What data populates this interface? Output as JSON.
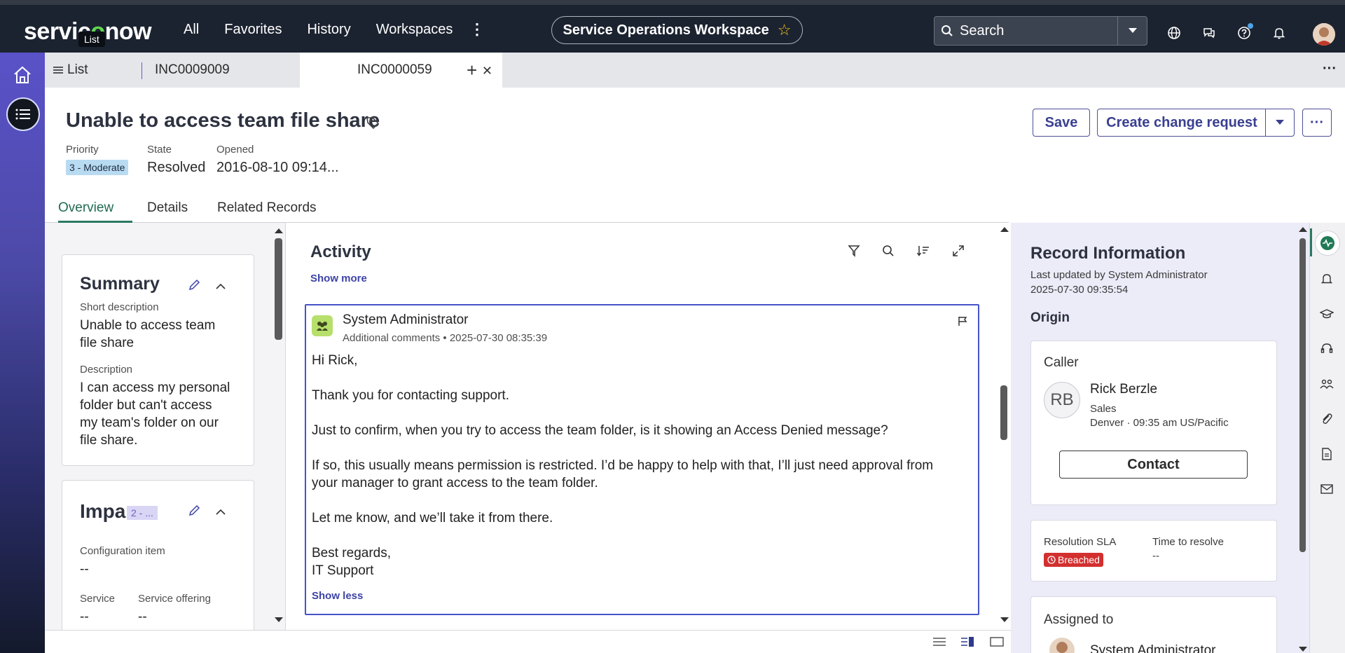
{
  "topnav": {
    "logo_prefix": "servic",
    "logo_o": "o",
    "logo_suffix": "now",
    "logo_tooltip": "List",
    "links": [
      "All",
      "Favorites",
      "History",
      "Workspaces"
    ],
    "workspace": "Service Operations Workspace",
    "search_placeholder": "Search",
    "icons": [
      "globe-icon",
      "chat-icon",
      "help-icon",
      "bell-icon"
    ]
  },
  "tabs": {
    "list_label": "List",
    "tab1": "INC0009009",
    "tab2": "INC0000059"
  },
  "record": {
    "title": "Unable to access team file share",
    "priority_label": "Priority",
    "priority_value": "3 - Moderate",
    "state_label": "State",
    "state_value": "Resolved",
    "opened_label": "Opened",
    "opened_value": "2016-08-10 09:14...",
    "save_label": "Save",
    "create_change_label": "Create change request"
  },
  "subtabs": [
    "Overview",
    "Details",
    "Related Records"
  ],
  "summary": {
    "title": "Summary",
    "short_desc_label": "Short description",
    "short_desc_line1": "Unable to access team",
    "short_desc_line2": "file share",
    "desc_label": "Description",
    "desc_lines": [
      "I can access my personal",
      "folder but can't access",
      "my team's folder on our",
      "file share."
    ]
  },
  "impact": {
    "title": "Impa",
    "badge": "2 - ...",
    "ci_label": "Configuration item",
    "ci_value": "--",
    "service_label": "Service",
    "service_value": "--",
    "offering_label": "Service offering",
    "offering_value": "--"
  },
  "activity": {
    "title": "Activity",
    "show_more": "Show more",
    "show_less": "Show less",
    "author": "System Administrator",
    "meta": "Additional comments • 2025-07-30 08:35:39",
    "lines": [
      "Hi Rick,",
      "Thank you for contacting support.",
      "Just to confirm, when you try to access the team folder, is it showing an Access Denied message?",
      "If so, this usually means permission is restricted. I’d be happy to help with that, I’ll just need approval from",
      "your manager to grant access to the team folder.",
      "Let me know, and we’ll take it from there.",
      "Best regards,",
      "IT Support"
    ]
  },
  "record_info": {
    "title": "Record Information",
    "last_updated": "Last updated by System Administrator",
    "last_updated_time": "2025-07-30 09:35:54",
    "origin": "Origin",
    "caller_label": "Caller",
    "caller_initials": "RB",
    "caller_name": "Rick Berzle",
    "caller_dept": "Sales",
    "caller_loc": "Denver · 09:35 am US/Pacific",
    "contact_label": "Contact",
    "sla_label": "Resolution SLA",
    "sla_value": "Breached",
    "ttr_label": "Time to resolve",
    "ttr_value": "--",
    "assigned_label": "Assigned to",
    "assigned_name": "System Administrator"
  },
  "colors": {
    "nav_bg": "#1c2330",
    "accent": "#3a3f91",
    "rail_top": "#5a52c8",
    "breached": "#d32f2f",
    "active_tab": "#2a7a60"
  }
}
